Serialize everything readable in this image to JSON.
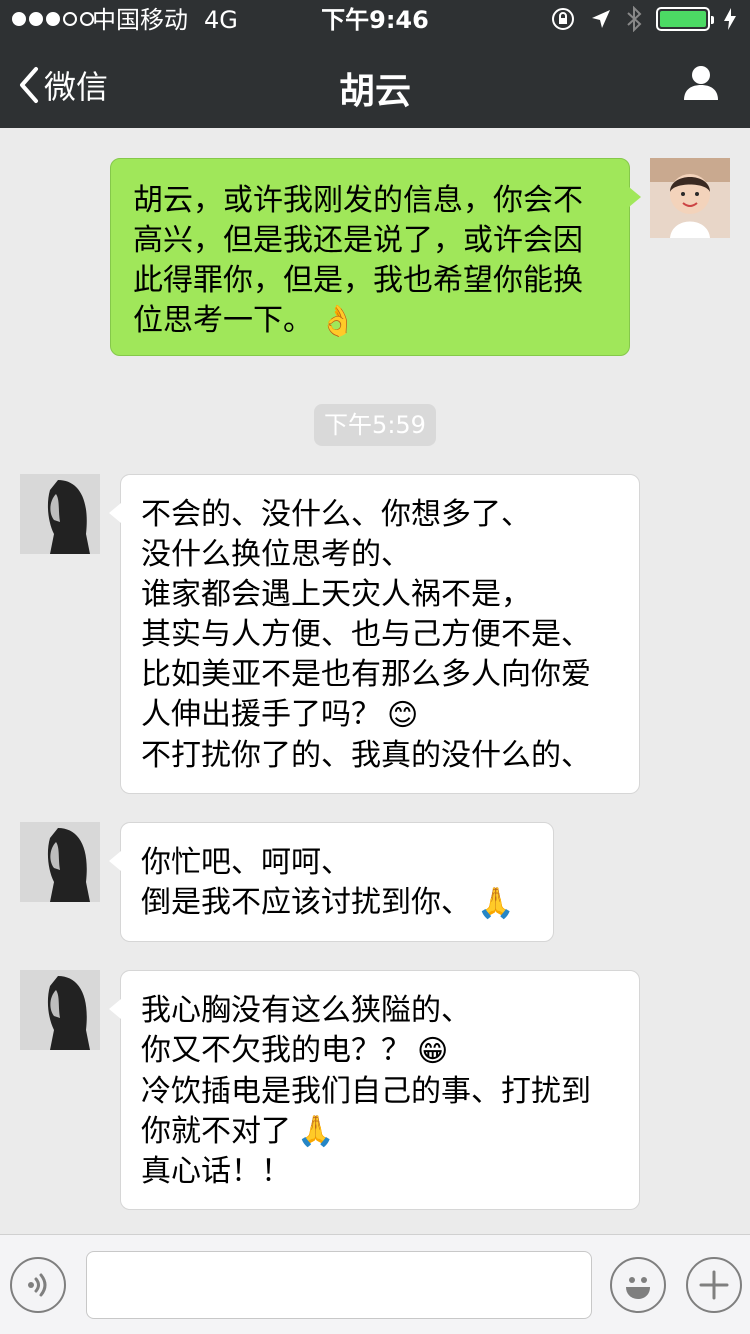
{
  "status_bar": {
    "carrier": "中国移动",
    "network": "4G",
    "time": "下午9:46",
    "battery_level": 1.0
  },
  "nav": {
    "back_label": "微信",
    "title": "胡云",
    "icons": [
      "chevron-left-icon",
      "profile-icon"
    ]
  },
  "messages": {
    "m1": {
      "sender": "me",
      "lines": [
        "胡云，或许我刚发的信息，你会不",
        "高兴，但是我还是说了，或许会因",
        "此得罪你，但是，我也希望你能换",
        "位思考一下。"
      ],
      "emoji": "👌"
    },
    "timestamp": "下午5:59",
    "m2": {
      "sender": "other",
      "lines": [
        "不会的、没什么、你想多了、",
        "没什么换位思考的、",
        "谁家都会遇上天灾人祸不是，",
        "其实与人方便、也与己方便不是、",
        "比如美亚不是也有那么多人向你爱",
        "人伸出援手了吗？",
        "不打扰你了的、我真的没什么的、"
      ],
      "emoji": "😊"
    },
    "m3": {
      "sender": "other",
      "lines": [
        "你忙吧、呵呵、",
        "倒是我不应该讨扰到你、"
      ],
      "emoji": "🙏"
    },
    "m4": {
      "sender": "other",
      "lines": [
        "我心胸没有这么狭隘的、",
        "你又不欠我的电？？",
        "冷饮插电是我们自己的事、打扰到",
        "你就不对了",
        "真心话！！"
      ],
      "emoji_line2": "😁",
      "emoji_line4": "🙏"
    }
  },
  "input_bar": {
    "text_value": "",
    "icons": [
      "voice-icon",
      "emoji-icon",
      "plus-icon"
    ]
  },
  "colors": {
    "nav_bg": "#2e3133",
    "chat_bg": "#ebebeb",
    "my_bubble": "#a0e75a",
    "other_bubble": "#ffffff",
    "battery_fill": "#4cd964"
  }
}
